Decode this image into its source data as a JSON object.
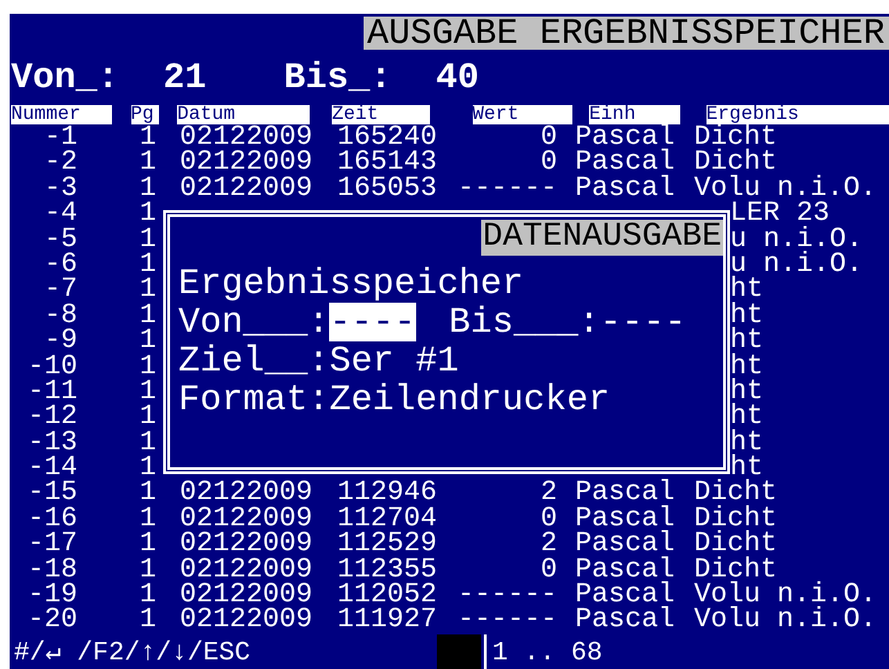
{
  "title": "AUSGABE ERGEBNISSPEICHER",
  "range": {
    "from_label": "Von_:",
    "from": "21",
    "to_label": "Bis_:",
    "to": "40"
  },
  "table": {
    "columns": [
      "Nummer",
      "Pg",
      "Datum",
      "Zeit",
      "Wert",
      "Einh",
      "Ergebnis"
    ],
    "rows": [
      {
        "cells": [
          "-1",
          "1",
          "02122009",
          "165240",
          "0",
          "Pascal",
          "Dicht"
        ]
      },
      {
        "cells": [
          "-2",
          "1",
          "02122009",
          "165143",
          "0",
          "Pascal",
          "Dicht"
        ]
      },
      {
        "cells": [
          "-3",
          "1",
          "02122009",
          "165053",
          "------",
          "Pascal",
          "Volu n.i.O."
        ]
      },
      {
        "cells": [
          "-4",
          "1"
        ],
        "peek": "LER 23"
      },
      {
        "cells": [
          "-5",
          "1"
        ],
        "peek": "u n.i.O."
      },
      {
        "cells": [
          "-6",
          "1"
        ],
        "peek": "u n.i.O."
      },
      {
        "cells": [
          "-7",
          "1"
        ],
        "peek": "ht"
      },
      {
        "cells": [
          "-8",
          "1"
        ],
        "peek": "ht"
      },
      {
        "cells": [
          "-9",
          "1"
        ],
        "peek": "ht"
      },
      {
        "cells": [
          "-10",
          "1"
        ],
        "peek": "ht"
      },
      {
        "cells": [
          "-11",
          "1"
        ],
        "peek": "ht"
      },
      {
        "cells": [
          "-12",
          "1"
        ],
        "peek": "ht"
      },
      {
        "cells": [
          "-13",
          "1"
        ],
        "peek": "ht"
      },
      {
        "cells": [
          "-14",
          "1"
        ],
        "peek": "ht"
      },
      {
        "cells": [
          "-15",
          "1",
          "02122009",
          "112946",
          "2",
          "Pascal",
          "Dicht"
        ]
      },
      {
        "cells": [
          "-16",
          "1",
          "02122009",
          "112704",
          "0",
          "Pascal",
          "Dicht"
        ]
      },
      {
        "cells": [
          "-17",
          "1",
          "02122009",
          "112529",
          "2",
          "Pascal",
          "Dicht"
        ]
      },
      {
        "cells": [
          "-18",
          "1",
          "02122009",
          "112355",
          "0",
          "Pascal",
          "Dicht"
        ]
      },
      {
        "cells": [
          "-19",
          "1",
          "02122009",
          "112052",
          "------",
          "Pascal",
          "Volu n.i.O."
        ]
      },
      {
        "cells": [
          "-20",
          "1",
          "02122009",
          "111927",
          "------",
          "Pascal",
          "Volu n.i.O."
        ]
      }
    ]
  },
  "dialog": {
    "title": "DATENAUSGABE",
    "heading": "Ergebnisspeicher",
    "fields": [
      {
        "label": "Von___:",
        "value": "----",
        "selected": true
      },
      {
        "label": "Bis___:",
        "value": "----",
        "selected": false
      }
    ],
    "lines": [
      {
        "label": "Ziel__:",
        "value": "Ser #1"
      },
      {
        "label": "Format:",
        "value": "Zeilendrucker"
      }
    ]
  },
  "status_bar": {
    "keys": "#/↵ /F2/↑/↓/ESC",
    "range": "1 .. 68"
  }
}
